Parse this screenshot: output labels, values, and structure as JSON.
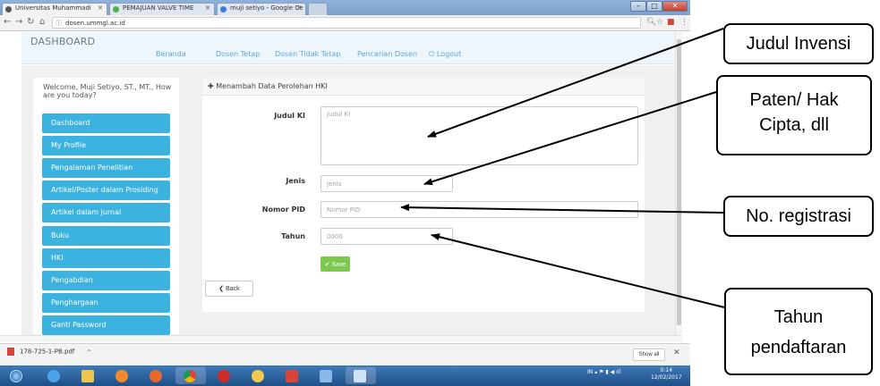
{
  "browser": {
    "tabs": [
      {
        "label": "Universitas Muhammadi"
      },
      {
        "label": "PEMAJUAN VALVE TIME"
      },
      {
        "label": "muji setiyo - Google Ce"
      }
    ],
    "address": "dosen.ummgl.ac.id"
  },
  "site": {
    "brand": "DASHBOARD",
    "nav": [
      "Beranda",
      "Dosen Tetap",
      "Dosen Tidak Tetap",
      "Pencarian Dosen",
      "Logout"
    ]
  },
  "sidebar": {
    "welcome": "Welcome, Muji Setiyo, ST., MT., How are you today?",
    "items": [
      {
        "label": "Dashboard"
      },
      {
        "label": "My Profile"
      },
      {
        "label": "Pengalaman Penelitian"
      },
      {
        "label": "Artikel/Poster dalam Prosiding"
      },
      {
        "label": "Artikel dalam jurnal"
      },
      {
        "label": "Buku"
      },
      {
        "label": "HKI"
      },
      {
        "label": "Pengabdian"
      },
      {
        "label": "Penghargaan"
      },
      {
        "label": "Ganti Password"
      }
    ]
  },
  "form": {
    "title": "Menambah Data Perolehan HKI",
    "judul_label": "Judul KI",
    "judul_placeholder": "Judul KI",
    "jenis_label": "Jenis",
    "jenis_placeholder": "Jenis",
    "pid_label": "Nomor PID",
    "pid_placeholder": "Nomor PID",
    "tahun_label": "Tahun",
    "tahun_placeholder": "0000",
    "save_label": "Save",
    "back_label": "Back"
  },
  "downloads": {
    "file": "178-725-1-PB.pdf",
    "show_all": "Show all"
  },
  "taskbar": {
    "tray": "IN",
    "time": "0:14",
    "date": "12/02/2017"
  },
  "annotations": {
    "judul": "Judul Invensi",
    "jenis": "Paten/ Hak Cipta, dll",
    "pid": "No. registrasi",
    "tahun": "Tahun pendaftaran"
  }
}
